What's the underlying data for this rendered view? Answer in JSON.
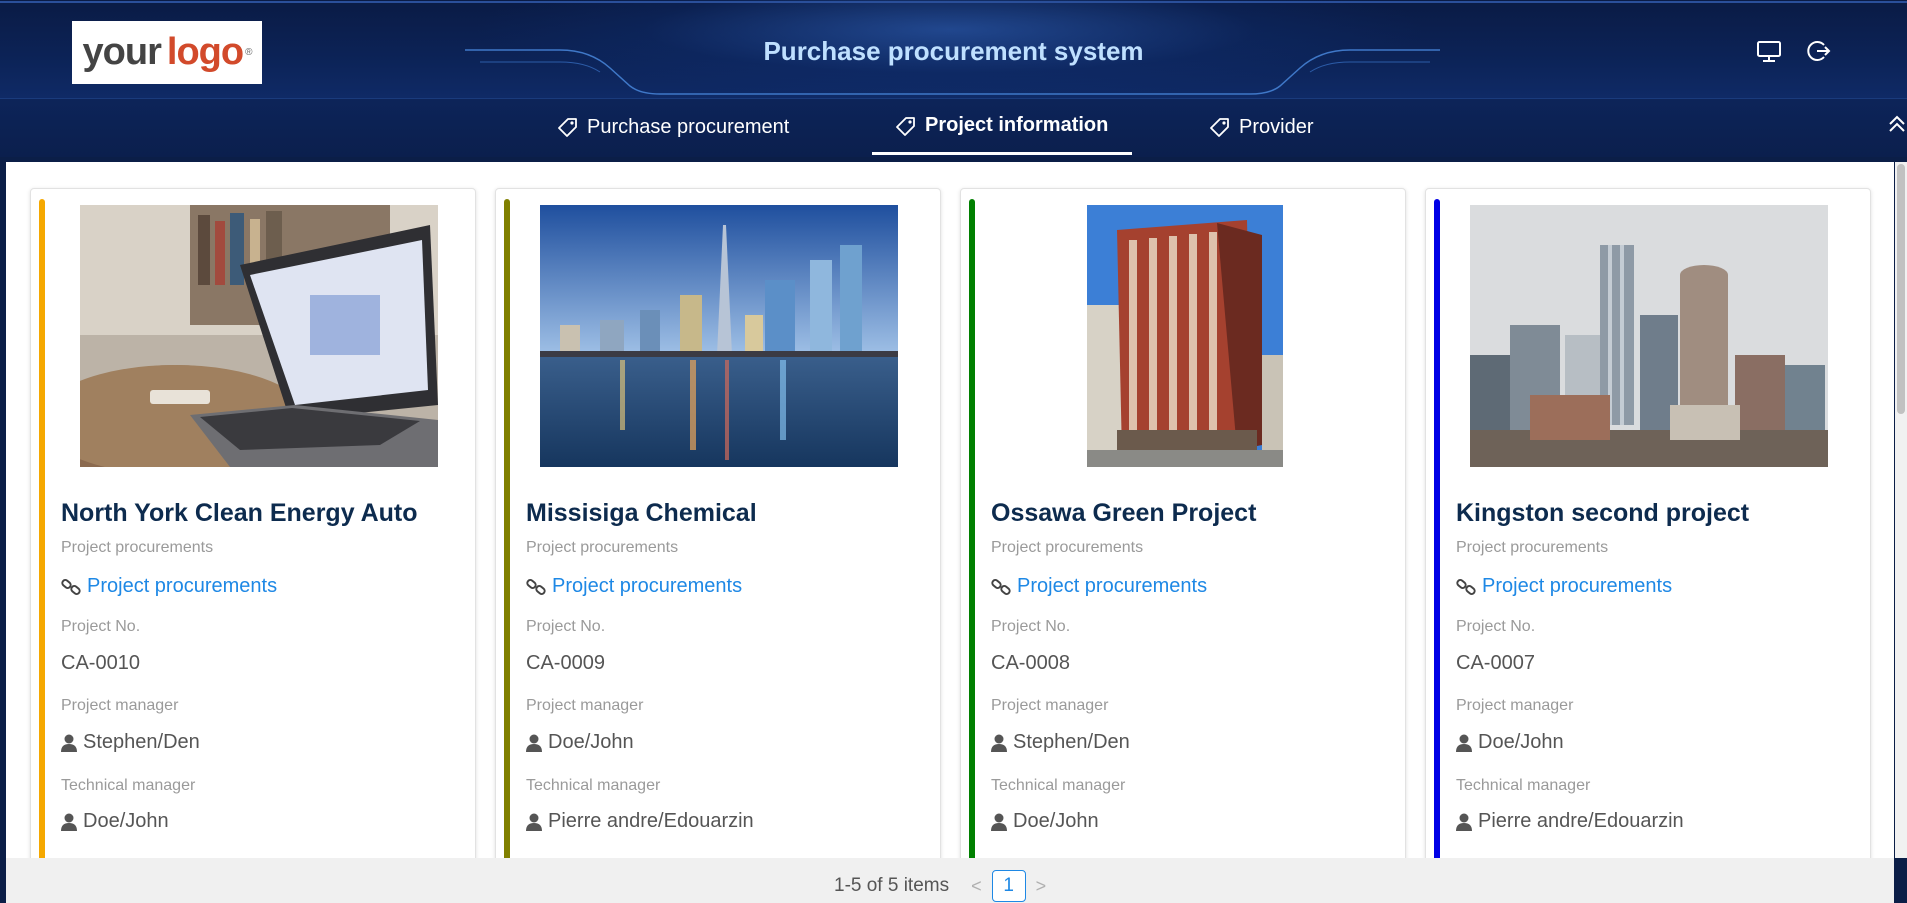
{
  "header": {
    "logo_text_your": "your",
    "logo_text_logo": "logo",
    "logo_registered": "®",
    "title": "Purchase procurement system",
    "icons": [
      "monitor-icon",
      "logout-icon"
    ]
  },
  "nav": {
    "tabs": [
      {
        "label": "Purchase procurement",
        "active": false
      },
      {
        "label": "Project information",
        "active": true
      },
      {
        "label": "Provider",
        "active": false
      }
    ]
  },
  "cards": [
    {
      "accent": "#f5a800",
      "title": "North York Clean Energy Auto",
      "procurements_label": "Project procurements",
      "procurements_link": "Project procurements",
      "project_no_label": "Project No.",
      "project_no": "CA-0010",
      "project_manager_label": "Project manager",
      "project_manager": "Stephen/Den",
      "technical_manager_label": "Technical manager",
      "technical_manager": "Doe/John"
    },
    {
      "accent": "#808000",
      "title": "Missisiga Chemical",
      "procurements_label": "Project procurements",
      "procurements_link": "Project procurements",
      "project_no_label": "Project No.",
      "project_no": "CA-0009",
      "project_manager_label": "Project manager",
      "project_manager": "Doe/John",
      "technical_manager_label": "Technical manager",
      "technical_manager": "Pierre andre/Edouarzin"
    },
    {
      "accent": "#008000",
      "title": "Ossawa Green Project",
      "procurements_label": "Project procurements",
      "procurements_link": "Project procurements",
      "project_no_label": "Project No.",
      "project_no": "CA-0008",
      "project_manager_label": "Project manager",
      "project_manager": "Stephen/Den",
      "technical_manager_label": "Technical manager",
      "technical_manager": "Doe/John"
    },
    {
      "accent": "#0000e6",
      "title": "Kingston second project",
      "procurements_label": "Project procurements",
      "procurements_link": "Project procurements",
      "project_no_label": "Project No.",
      "project_no": "CA-0007",
      "project_manager_label": "Project manager",
      "project_manager": "Doe/John",
      "technical_manager_label": "Technical manager",
      "technical_manager": "Pierre andre/Edouarzin"
    }
  ],
  "pagination": {
    "summary": "1-5 of 5 items",
    "current_page": "1",
    "prev": "<",
    "next": ">"
  },
  "colors": {
    "header_bg": "#0c2357",
    "title": "#bfe0ff",
    "link": "#1e88e5"
  }
}
